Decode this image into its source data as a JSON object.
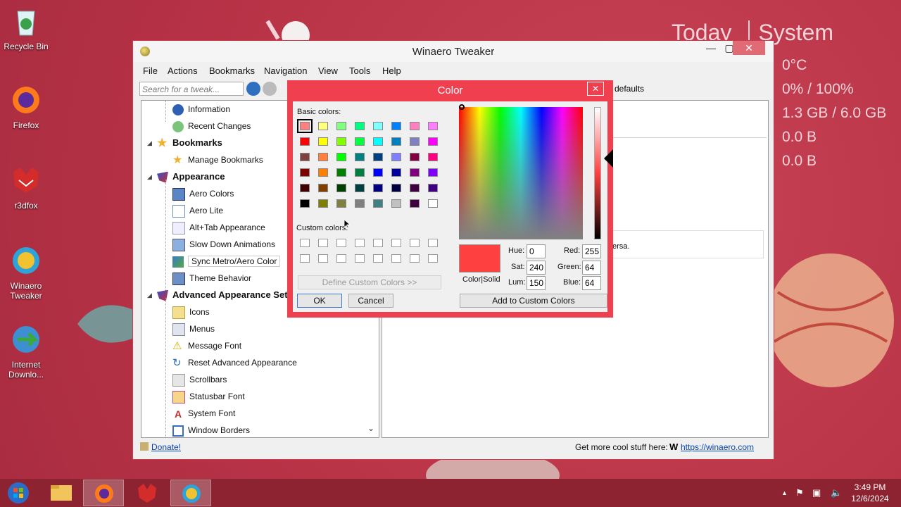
{
  "desktop": {
    "icons": [
      {
        "label": "Recycle Bin"
      },
      {
        "label": "Firefox"
      },
      {
        "label": "r3dfox"
      },
      {
        "label": "Winaero Tweaker"
      },
      {
        "label": "Internet Downlo..."
      }
    ]
  },
  "widget": {
    "tab_today": "Today",
    "tab_system": "System",
    "rows": [
      "0°C",
      "0% / 100%",
      "1.3 GB / 6.0 GB",
      "0.0 B",
      "0.0 B"
    ]
  },
  "window": {
    "title": "Winaero Tweaker",
    "menu": [
      "File",
      "Actions",
      "Bookmarks",
      "Navigation",
      "View",
      "Tools",
      "Help"
    ],
    "search_placeholder": "Search for a tweak...",
    "toolbar_partial": "defaults",
    "tree": {
      "items": [
        {
          "label": "Information",
          "kind": "child"
        },
        {
          "label": "Recent Changes",
          "kind": "child"
        },
        {
          "label": "Bookmarks",
          "kind": "category"
        },
        {
          "label": "Manage Bookmarks",
          "kind": "child"
        },
        {
          "label": "Appearance",
          "kind": "category"
        },
        {
          "label": "Aero Colors",
          "kind": "child"
        },
        {
          "label": "Aero Lite",
          "kind": "child"
        },
        {
          "label": "Alt+Tab Appearance",
          "kind": "child"
        },
        {
          "label": "Slow Down Animations",
          "kind": "child"
        },
        {
          "label": "Sync Metro/Aero Color",
          "kind": "child"
        },
        {
          "label": "Theme Behavior",
          "kind": "child"
        },
        {
          "label": "Advanced Appearance Settings",
          "kind": "category"
        },
        {
          "label": "Icons",
          "kind": "child"
        },
        {
          "label": "Menus",
          "kind": "child"
        },
        {
          "label": "Message Font",
          "kind": "child"
        },
        {
          "label": "Reset Advanced Appearance",
          "kind": "child"
        },
        {
          "label": "Scrollbars",
          "kind": "child"
        },
        {
          "label": "Statusbar Font",
          "kind": "child"
        },
        {
          "label": "System Font",
          "kind": "child"
        },
        {
          "label": "Window Borders",
          "kind": "child"
        }
      ]
    },
    "right_partial_text": "ersa.",
    "status": {
      "donate": "Donate!",
      "more_text": "Get more cool stuff here:",
      "link": "https://winaero.com"
    }
  },
  "color_dialog": {
    "title": "Color",
    "basic_colors_label": "Basic colors:",
    "custom_colors_label": "Custom colors:",
    "basic_colors": [
      [
        "#ff8080",
        "#ffff80",
        "#80ff80",
        "#00ff80",
        "#80ffff",
        "#0080ff",
        "#ff80c0",
        "#ff80ff"
      ],
      [
        "#ff0000",
        "#ffff00",
        "#80ff00",
        "#00ff40",
        "#00ffff",
        "#0080c0",
        "#8080c0",
        "#ff00ff"
      ],
      [
        "#804040",
        "#ff8040",
        "#00ff00",
        "#008080",
        "#004080",
        "#8080ff",
        "#800040",
        "#ff0080"
      ],
      [
        "#800000",
        "#ff8000",
        "#008000",
        "#008040",
        "#0000ff",
        "#0000a0",
        "#800080",
        "#8000ff"
      ],
      [
        "#400000",
        "#804000",
        "#004000",
        "#004040",
        "#000080",
        "#000040",
        "#400040",
        "#400080"
      ],
      [
        "#000000",
        "#808000",
        "#808040",
        "#808080",
        "#408080",
        "#c0c0c0",
        "#400040",
        "#ffffff"
      ]
    ],
    "define_custom_button": "Define Custom Colors >>",
    "ok_button": "OK",
    "cancel_button": "Cancel",
    "preview_label": "Color|Solid",
    "preview_color": "#ff4040",
    "hue_label": "Hue:",
    "hue": "0",
    "sat_label": "Sat:",
    "sat": "240",
    "lum_label": "Lum:",
    "lum": "150",
    "red_label": "Red:",
    "red": "255",
    "green_label": "Green:",
    "green": "64",
    "blue_label": "Blue:",
    "blue": "64",
    "add_custom_button": "Add to Custom Colors"
  },
  "taskbar": {
    "time": "3:49 PM",
    "date": "12/6/2024"
  }
}
